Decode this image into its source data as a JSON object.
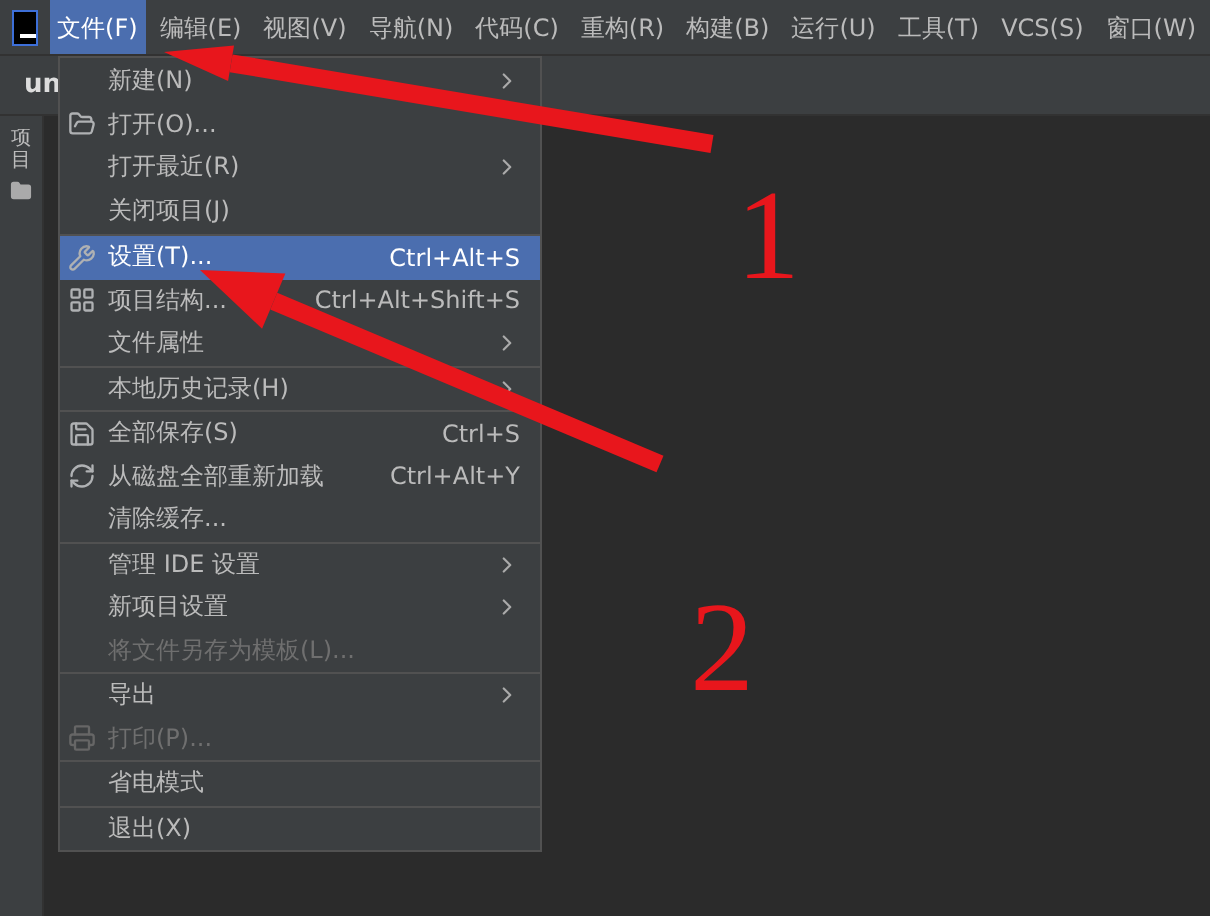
{
  "menubar": [
    {
      "label": "文件(F)",
      "selected": true
    },
    {
      "label": "编辑(E)",
      "selected": false
    },
    {
      "label": "视图(V)",
      "selected": false
    },
    {
      "label": "导航(N)",
      "selected": false
    },
    {
      "label": "代码(C)",
      "selected": false
    },
    {
      "label": "重构(R)",
      "selected": false
    },
    {
      "label": "构建(B)",
      "selected": false
    },
    {
      "label": "运行(U)",
      "selected": false
    },
    {
      "label": "工具(T)",
      "selected": false
    },
    {
      "label": "VCS(S)",
      "selected": false
    },
    {
      "label": "窗口(W)",
      "selected": false
    }
  ],
  "tab": {
    "label": "un"
  },
  "sidebar": {
    "label": "项目"
  },
  "menu": {
    "groups": [
      [
        {
          "label": "新建(N)",
          "submenu": true,
          "disabled": false,
          "selected": false
        },
        {
          "label": "打开(O)...",
          "kind": "folder",
          "submenu": false,
          "disabled": false,
          "selected": false
        },
        {
          "label": "打开最近(R)",
          "submenu": true,
          "disabled": false,
          "selected": false
        },
        {
          "label": "关闭项目(J)",
          "submenu": false,
          "disabled": false,
          "selected": false
        }
      ],
      [
        {
          "label": "设置(T)...",
          "kind": "wrench",
          "shortcut": "Ctrl+Alt+S",
          "submenu": false,
          "disabled": false,
          "selected": true
        },
        {
          "label": "项目结构...",
          "kind": "structure",
          "shortcut": "Ctrl+Alt+Shift+S",
          "submenu": false,
          "disabled": false,
          "selected": false
        },
        {
          "label": "文件属性",
          "submenu": true,
          "disabled": false,
          "selected": false
        }
      ],
      [
        {
          "label": "本地历史记录(H)",
          "submenu": true,
          "disabled": false,
          "selected": false
        }
      ],
      [
        {
          "label": "全部保存(S)",
          "kind": "save",
          "shortcut": "Ctrl+S",
          "submenu": false,
          "disabled": false,
          "selected": false
        },
        {
          "label": "从磁盘全部重新加载",
          "kind": "reload",
          "shortcut": "Ctrl+Alt+Y",
          "submenu": false,
          "disabled": false,
          "selected": false
        },
        {
          "label": "清除缓存...",
          "submenu": false,
          "disabled": false,
          "selected": false
        }
      ],
      [
        {
          "label": "管理 IDE 设置",
          "submenu": true,
          "disabled": false,
          "selected": false
        },
        {
          "label": "新项目设置",
          "submenu": true,
          "disabled": false,
          "selected": false
        },
        {
          "label": "将文件另存为模板(L)...",
          "submenu": false,
          "disabled": true,
          "selected": false
        }
      ],
      [
        {
          "label": "导出",
          "submenu": true,
          "disabled": false,
          "selected": false
        },
        {
          "label": "打印(P)...",
          "kind": "print",
          "submenu": false,
          "disabled": true,
          "selected": false
        }
      ],
      [
        {
          "label": "省电模式",
          "submenu": false,
          "disabled": false,
          "selected": false
        }
      ],
      [
        {
          "label": "退出(X)",
          "submenu": false,
          "disabled": false,
          "selected": false
        }
      ]
    ]
  },
  "annotations": [
    {
      "text": "1"
    },
    {
      "text": "2"
    }
  ]
}
